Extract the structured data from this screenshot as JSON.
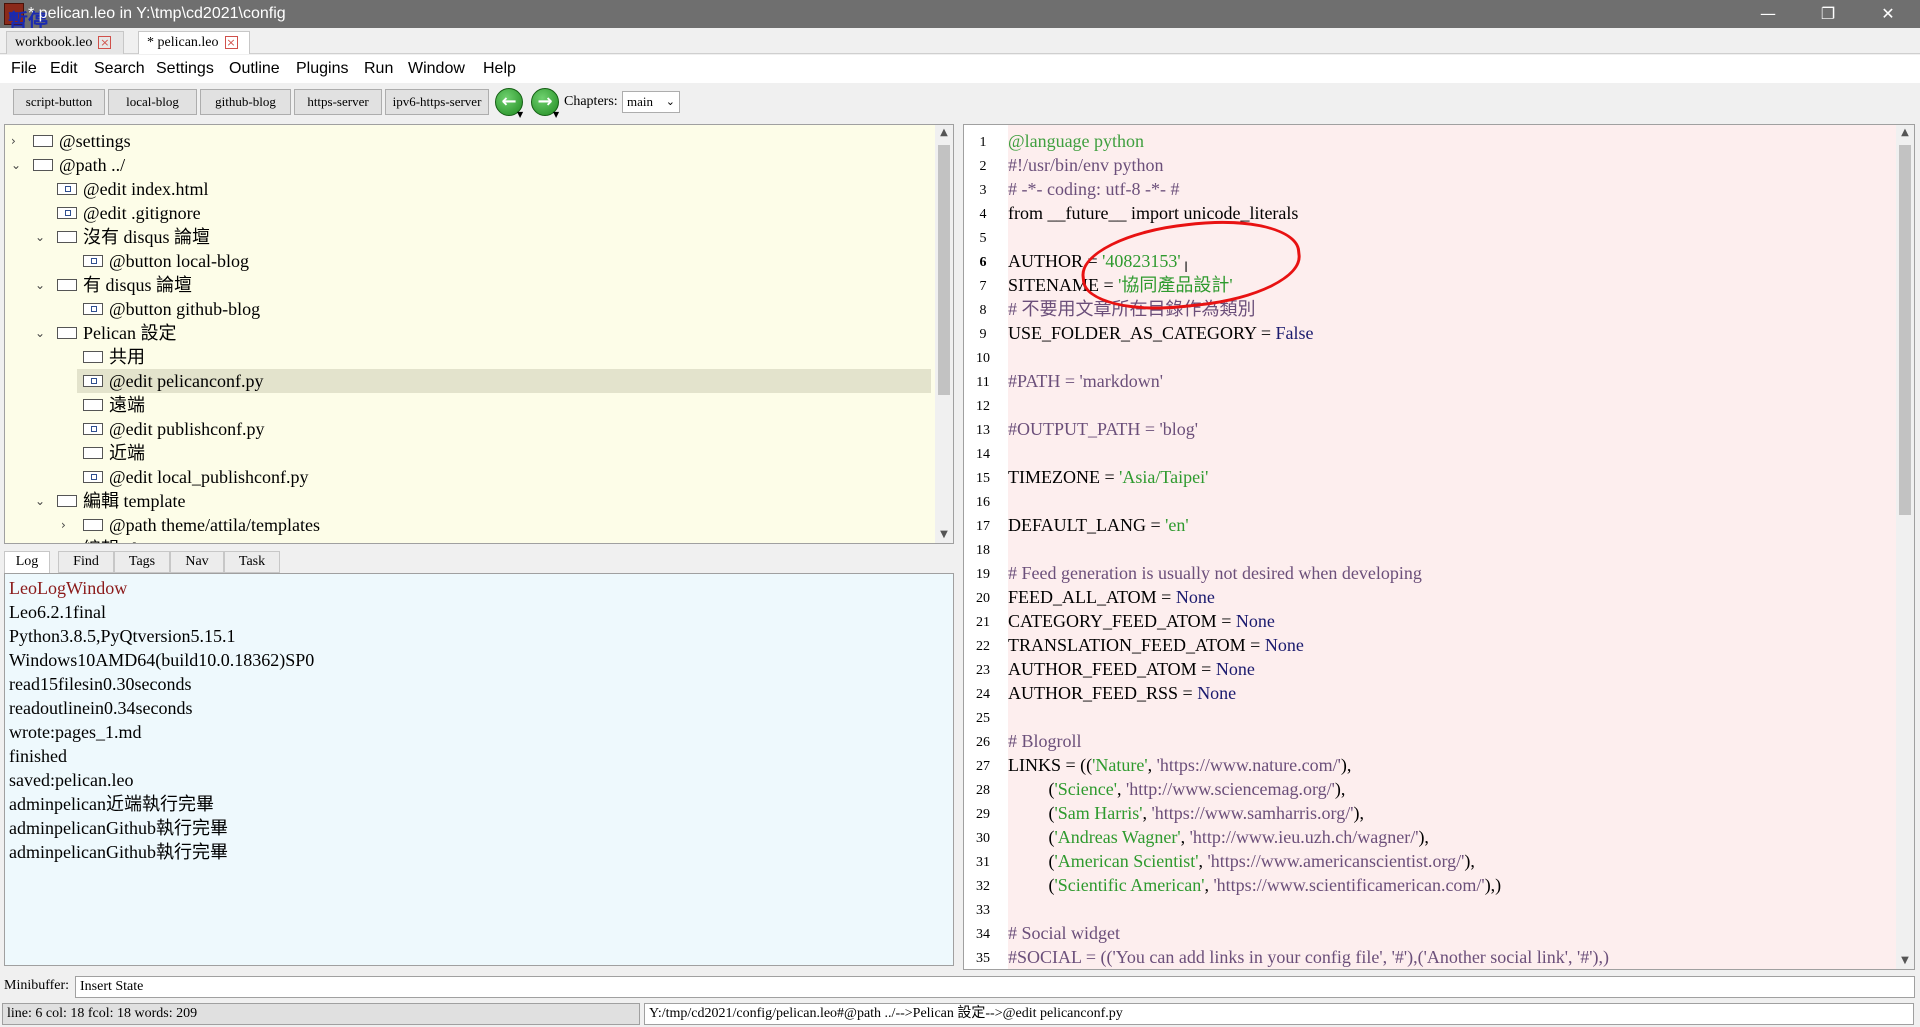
{
  "window": {
    "title": "* pelican.leo in Y:\\tmp\\cd2021\\config",
    "pause_label": "暫停",
    "minimize": "—",
    "maximize": "❐",
    "close": "✕"
  },
  "doc_tabs": [
    {
      "label": "workbook.leo"
    },
    {
      "label": "* pelican.leo"
    }
  ],
  "menu": [
    "File",
    "Edit",
    "Search",
    "Settings",
    "Outline",
    "Plugins",
    "Run",
    "Window",
    "Help"
  ],
  "toolbar": {
    "buttons": [
      "script-button",
      "local-blog",
      "github-blog",
      "https-server",
      "ipv6-https-server"
    ],
    "chapters_label": "Chapters:",
    "chapters_value": "main"
  },
  "outline": [
    {
      "text": "@settings",
      "arrow": "›",
      "depth": 0
    },
    {
      "text": "@path ../",
      "arrow": "⌄",
      "depth": 0
    },
    {
      "text": "@edit index.html",
      "arrow": "",
      "depth": 1
    },
    {
      "text": "@edit .gitignore",
      "arrow": "",
      "depth": 1
    },
    {
      "text": "沒有 disqus 論壇",
      "arrow": "⌄",
      "depth": 1
    },
    {
      "text": "@button local-blog",
      "arrow": "",
      "depth": 2
    },
    {
      "text": "有 disqus 論壇",
      "arrow": "⌄",
      "depth": 1
    },
    {
      "text": "@button github-blog",
      "arrow": "",
      "depth": 2
    },
    {
      "text": "Pelican 設定",
      "arrow": "⌄",
      "depth": 1
    },
    {
      "text": "共用",
      "arrow": "",
      "depth": 2
    },
    {
      "text": "@edit pelicanconf.py",
      "arrow": "",
      "depth": 2,
      "selected": true
    },
    {
      "text": "遠端",
      "arrow": "",
      "depth": 2
    },
    {
      "text": "@edit publishconf.py",
      "arrow": "",
      "depth": 2
    },
    {
      "text": "近端",
      "arrow": "",
      "depth": 2
    },
    {
      "text": "@edit local_publishconf.py",
      "arrow": "",
      "depth": 2
    },
    {
      "text": "編輯 template",
      "arrow": "⌄",
      "depth": 1
    },
    {
      "text": "@path theme/attila/templates",
      "arrow": "›",
      "depth": 2
    },
    {
      "text": "編輯 plugin",
      "arrow": "⌄",
      "depth": 1
    }
  ],
  "log_tabs": [
    "Log",
    "Find",
    "Tags",
    "Nav",
    "Task"
  ],
  "log_lines": [
    "LeoLogWindow",
    "Leo6.2.1final",
    "Python3.8.5,PyQtversion5.15.1",
    "Windows10AMD64(build10.0.18362)SP0",
    "read15filesin0.30seconds",
    "readoutlinein0.34seconds",
    "wrote:pages_1.md",
    "finished",
    "saved:pelican.leo",
    "adminpelican近端執行完畢",
    "adminpelicanGithub執行完畢",
    "adminpelicanGithub執行完畢"
  ],
  "editor": {
    "lines": [
      [
        {
          "t": "@language python",
          "c": "c-lang"
        }
      ],
      [
        {
          "t": "#!/usr/bin/env python",
          "c": "c-grey"
        }
      ],
      [
        {
          "t": "# -*- coding: utf-8 -*- #",
          "c": "c-grey"
        }
      ],
      [
        {
          "t": "from __future__ import unicode_literals",
          "c": ""
        }
      ],
      [],
      [
        {
          "t": "AUTHOR = ",
          "c": ""
        },
        {
          "t": "'40823153'",
          "c": "c-str"
        }
      ],
      [
        {
          "t": "SITENAME = ",
          "c": ""
        },
        {
          "t": "'協同產品設計'",
          "c": "c-str"
        }
      ],
      [
        {
          "t": "# 不要用文章所在目錄作為類別",
          "c": "c-grey"
        }
      ],
      [
        {
          "t": "USE_FOLDER_AS_CATEGORY = ",
          "c": ""
        },
        {
          "t": "False",
          "c": "c-kw"
        }
      ],
      [],
      [
        {
          "t": "#PATH = 'markdown'",
          "c": "c-grey"
        }
      ],
      [],
      [
        {
          "t": "#OUTPUT_PATH = 'blog'",
          "c": "c-grey"
        }
      ],
      [],
      [
        {
          "t": "TIMEZONE = ",
          "c": ""
        },
        {
          "t": "'Asia/Taipei'",
          "c": "c-str"
        }
      ],
      [],
      [
        {
          "t": "DEFAULT_LANG = ",
          "c": ""
        },
        {
          "t": "'en'",
          "c": "c-str"
        }
      ],
      [],
      [
        {
          "t": "# Feed generation is usually not desired when developing",
          "c": "c-grey"
        }
      ],
      [
        {
          "t": "FEED_ALL_ATOM = ",
          "c": ""
        },
        {
          "t": "None",
          "c": "c-kw"
        }
      ],
      [
        {
          "t": "CATEGORY_FEED_ATOM = ",
          "c": ""
        },
        {
          "t": "None",
          "c": "c-kw"
        }
      ],
      [
        {
          "t": "TRANSLATION_FEED_ATOM = ",
          "c": ""
        },
        {
          "t": "None",
          "c": "c-kw"
        }
      ],
      [
        {
          "t": "AUTHOR_FEED_ATOM = ",
          "c": ""
        },
        {
          "t": "None",
          "c": "c-kw"
        }
      ],
      [
        {
          "t": "AUTHOR_FEED_RSS = ",
          "c": ""
        },
        {
          "t": "None",
          "c": "c-kw"
        }
      ],
      [],
      [
        {
          "t": "# Blogroll",
          "c": "c-grey"
        }
      ],
      [
        {
          "t": "LINKS = ((",
          "c": ""
        },
        {
          "t": "'Nature'",
          "c": "c-str"
        },
        {
          "t": ", ",
          "c": ""
        },
        {
          "t": "'https://www.nature.com/'",
          "c": "c-grey"
        },
        {
          "t": "),",
          "c": ""
        }
      ],
      [
        {
          "t": "         (",
          "c": ""
        },
        {
          "t": "'Science'",
          "c": "c-str"
        },
        {
          "t": ", ",
          "c": ""
        },
        {
          "t": "'http://www.sciencemag.org/'",
          "c": "c-grey"
        },
        {
          "t": "),",
          "c": ""
        }
      ],
      [
        {
          "t": "         (",
          "c": ""
        },
        {
          "t": "'Sam Harris'",
          "c": "c-str"
        },
        {
          "t": ", ",
          "c": ""
        },
        {
          "t": "'https://www.samharris.org/'",
          "c": "c-grey"
        },
        {
          "t": "),",
          "c": ""
        }
      ],
      [
        {
          "t": "         (",
          "c": ""
        },
        {
          "t": "'Andreas Wagner'",
          "c": "c-str"
        },
        {
          "t": ", ",
          "c": ""
        },
        {
          "t": "'http://www.ieu.uzh.ch/wagner/'",
          "c": "c-grey"
        },
        {
          "t": "),",
          "c": ""
        }
      ],
      [
        {
          "t": "         (",
          "c": ""
        },
        {
          "t": "'American Scientist'",
          "c": "c-str"
        },
        {
          "t": ", ",
          "c": ""
        },
        {
          "t": "'https://www.americanscientist.org/'",
          "c": "c-grey"
        },
        {
          "t": "),",
          "c": ""
        }
      ],
      [
        {
          "t": "         (",
          "c": ""
        },
        {
          "t": "'Scientific American'",
          "c": "c-str"
        },
        {
          "t": ", ",
          "c": ""
        },
        {
          "t": "'https://www.scientificamerican.com/'",
          "c": "c-grey"
        },
        {
          "t": "),)",
          "c": ""
        }
      ],
      [],
      [
        {
          "t": "# Social widget",
          "c": "c-grey"
        }
      ],
      [
        {
          "t": "#SOCIAL = (('You can add links in your config file', '#'),('Another social link', '#'),)",
          "c": "c-grey"
        }
      ]
    ],
    "current_line": 6
  },
  "minibuffer": {
    "label": "Minibuffer:",
    "value": "Insert State"
  },
  "status": {
    "left": "line: 6 col: 18  fcol: 18 words: 209",
    "right": "Y:/tmp/cd2021/config/pelican.leo#@path ../-->Pelican 設定-->@edit pelicanconf.py"
  }
}
